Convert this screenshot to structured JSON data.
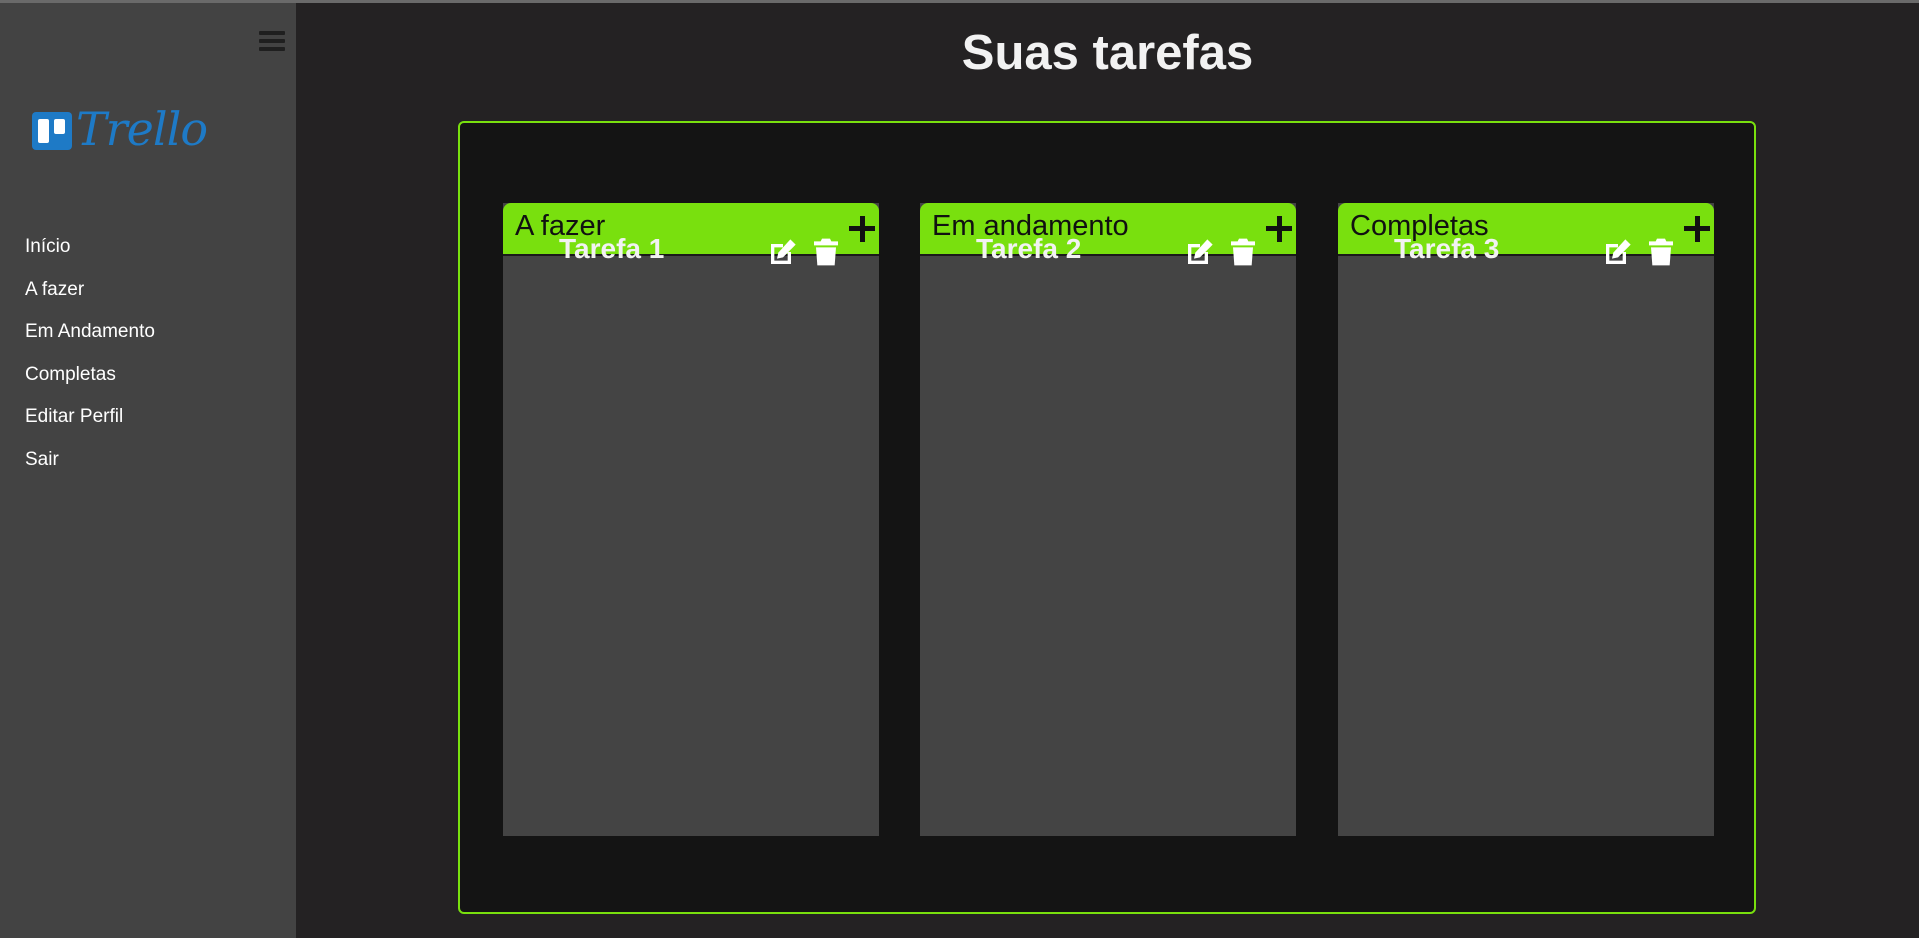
{
  "sidebar": {
    "logo_text": "Trello",
    "menu_icon": "hamburger-menu-icon",
    "items": [
      {
        "label": "Início"
      },
      {
        "label": "A fazer"
      },
      {
        "label": "Em Andamento"
      },
      {
        "label": "Completas"
      },
      {
        "label": "Editar Perfil"
      },
      {
        "label": "Sair"
      }
    ]
  },
  "main": {
    "title": "Suas tarefas",
    "columns": [
      {
        "title": "A fazer",
        "tasks": [
          {
            "title": "Tarefa 1"
          }
        ]
      },
      {
        "title": "Em andamento",
        "tasks": [
          {
            "title": "Tarefa 2"
          }
        ]
      },
      {
        "title": "Completas",
        "tasks": [
          {
            "title": "Tarefa 3"
          }
        ]
      }
    ]
  },
  "icons": {
    "add": "plus-icon",
    "edit": "edit-icon",
    "delete": "trash-icon"
  },
  "colors": {
    "accent": "#79e00e",
    "sidebar_bg": "#434343",
    "page_bg": "#242223",
    "board_bg": "#141414",
    "column_bg": "#444444",
    "logo": "#1e7ac6"
  }
}
